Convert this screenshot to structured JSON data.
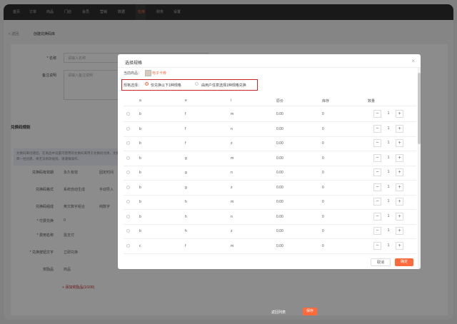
{
  "nav": {
    "items": [
      "首页",
      "订单",
      "商品",
      "门店",
      "会员",
      "营销",
      "数据",
      "应用",
      "财务",
      "设置"
    ],
    "active_index": 7
  },
  "breadcrumb": {
    "back": "< 返回",
    "title": "创建兑换码库"
  },
  "form": {
    "name_label": "* 名称",
    "name_placeholder": "请输入名称",
    "remark_label": "备注说明",
    "remark_placeholder": "请输入备注说明",
    "section_title": "兑换码规则",
    "tip": "兑换码库创建后，在商品中设置可使用的兑换码库用于兑换码兑换，兑换码库一经创建，将无法修改规则，请谨慎操作。",
    "rows": [
      {
        "label": "兑换码有效期",
        "value": "永久有效",
        "value2": "固定时间"
      },
      {
        "label": "兑换码格式",
        "value": "系统自动生成",
        "value2": "手动导入"
      },
      {
        "label": "兑换码组成",
        "value": "英文数字组合",
        "value2": "纯数字"
      },
      {
        "label": "* 付费兑换",
        "value": "0"
      },
      {
        "label": "* 费用名称",
        "value": "需支付"
      },
      {
        "label": "* 兑换按钮文字",
        "value": "立即兑换"
      },
      {
        "label": "奖励品",
        "value": "商品"
      }
    ],
    "add_link": "+ 添加奖励品(1/100)"
  },
  "footer": {
    "save_draft": "返回列表",
    "submit": "保存"
  },
  "modal": {
    "title": "选择规格",
    "close": "×",
    "current_label": "当前商品：",
    "current_value": "电子卡券",
    "spec_label": "规格选择：",
    "option1": "仅兑换以下1种规格",
    "option2": "由用户任意选择1种规格兑换",
    "option_selected": 1,
    "columns": [
      "a",
      "e",
      "i",
      "原价",
      "库存",
      "数量"
    ],
    "rows": [
      {
        "a": "b",
        "e": "f",
        "i": "m",
        "price": "0.00",
        "stock": "0",
        "qty": "1"
      },
      {
        "a": "b",
        "e": "f",
        "i": "n",
        "price": "0.00",
        "stock": "0",
        "qty": "1"
      },
      {
        "a": "b",
        "e": "f",
        "i": "z",
        "price": "0.00",
        "stock": "0",
        "qty": "1"
      },
      {
        "a": "b",
        "e": "g",
        "i": "m",
        "price": "0.00",
        "stock": "0",
        "qty": "1"
      },
      {
        "a": "b",
        "e": "g",
        "i": "n",
        "price": "0.00",
        "stock": "0",
        "qty": "1"
      },
      {
        "a": "b",
        "e": "g",
        "i": "z",
        "price": "0.00",
        "stock": "0",
        "qty": "1"
      },
      {
        "a": "b",
        "e": "h",
        "i": "m",
        "price": "0.00",
        "stock": "0",
        "qty": "1"
      },
      {
        "a": "b",
        "e": "h",
        "i": "n",
        "price": "0.00",
        "stock": "0",
        "qty": "1"
      },
      {
        "a": "b",
        "e": "h",
        "i": "z",
        "price": "0.00",
        "stock": "0",
        "qty": "1"
      },
      {
        "a": "c",
        "e": "f",
        "i": "m",
        "price": "0.00",
        "stock": "0",
        "qty": "1"
      }
    ],
    "cancel": "取消",
    "confirm": "确定"
  },
  "colors": {
    "accent": "#ff6a3d",
    "highlight_box": "#c62828",
    "nav_bg": "#2e2e2e"
  }
}
